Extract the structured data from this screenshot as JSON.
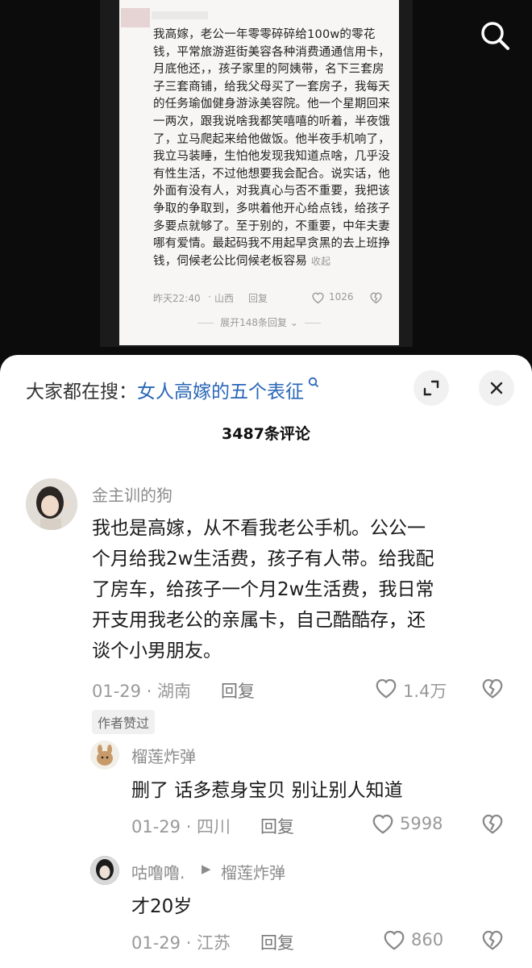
{
  "post": {
    "text": "我高嫁，老公一年零零碎碎给100w的零花钱，平常旅游逛街美容各种消费通通信用卡，月底他还，，孩子家里的阿姨带，名下三套房子三套商铺，给我父母买了一套房子，我每天的任务瑜伽健身游泳美容院。他一个星期回来一两次，跟我说啥我都笑嘻嘻的听着，半夜饿了，立马爬起来给他做饭。他半夜手机响了，我立马装睡，生怕他发现我知道点啥，几乎没有性生活，不过他想要我会配合。说实话，他外面有没有人，对我真心与否不重要，我把该争取的争取到，多哄着他开心给点钱，给孩子多要点就够了。至于别的，不重要，中年夫妻哪有爱情。最起码我不用起早贪黑的去上班挣钱，伺候老公比伺候老板容易",
    "fold_label": "收起",
    "time": "昨天22:40",
    "location": "山西",
    "reply_label": "回复",
    "likes": "1026",
    "expand_label": "展开148条回复"
  },
  "sheet": {
    "hot_prefix": "大家都在搜：",
    "hot_keyword": "女人高嫁的五个表征",
    "count_label": "3487条评论"
  },
  "comments": [
    {
      "user": "金主训的狗",
      "text_lines": [
        "我也是高嫁，从不看我老公手机。公公一",
        "个月给我2w生活费，孩子有人带。给我配",
        "了房车，给孩子一个月2w生活费，我日常",
        "开支用我老公的亲属卡，自己酷酷存，还",
        "谈个小男朋友。"
      ],
      "date": "01-29 · 湖南",
      "reply_label": "回复",
      "likes": "1.4万",
      "badge": "作者赞过"
    },
    {
      "user": "榴莲炸弹",
      "text": "删了 话多惹身宝贝 别让别人知道",
      "date": "01-29 · 四川",
      "reply_label": "回复",
      "likes": "5998"
    },
    {
      "user": "咕噜噜.",
      "reply_to": "榴莲炸弹",
      "text": "才20岁",
      "date": "01-29 · 江苏",
      "reply_label": "回复",
      "likes": "860"
    }
  ],
  "colors": {
    "link_blue": "#2a67b8",
    "meta_gray": "#999999"
  }
}
